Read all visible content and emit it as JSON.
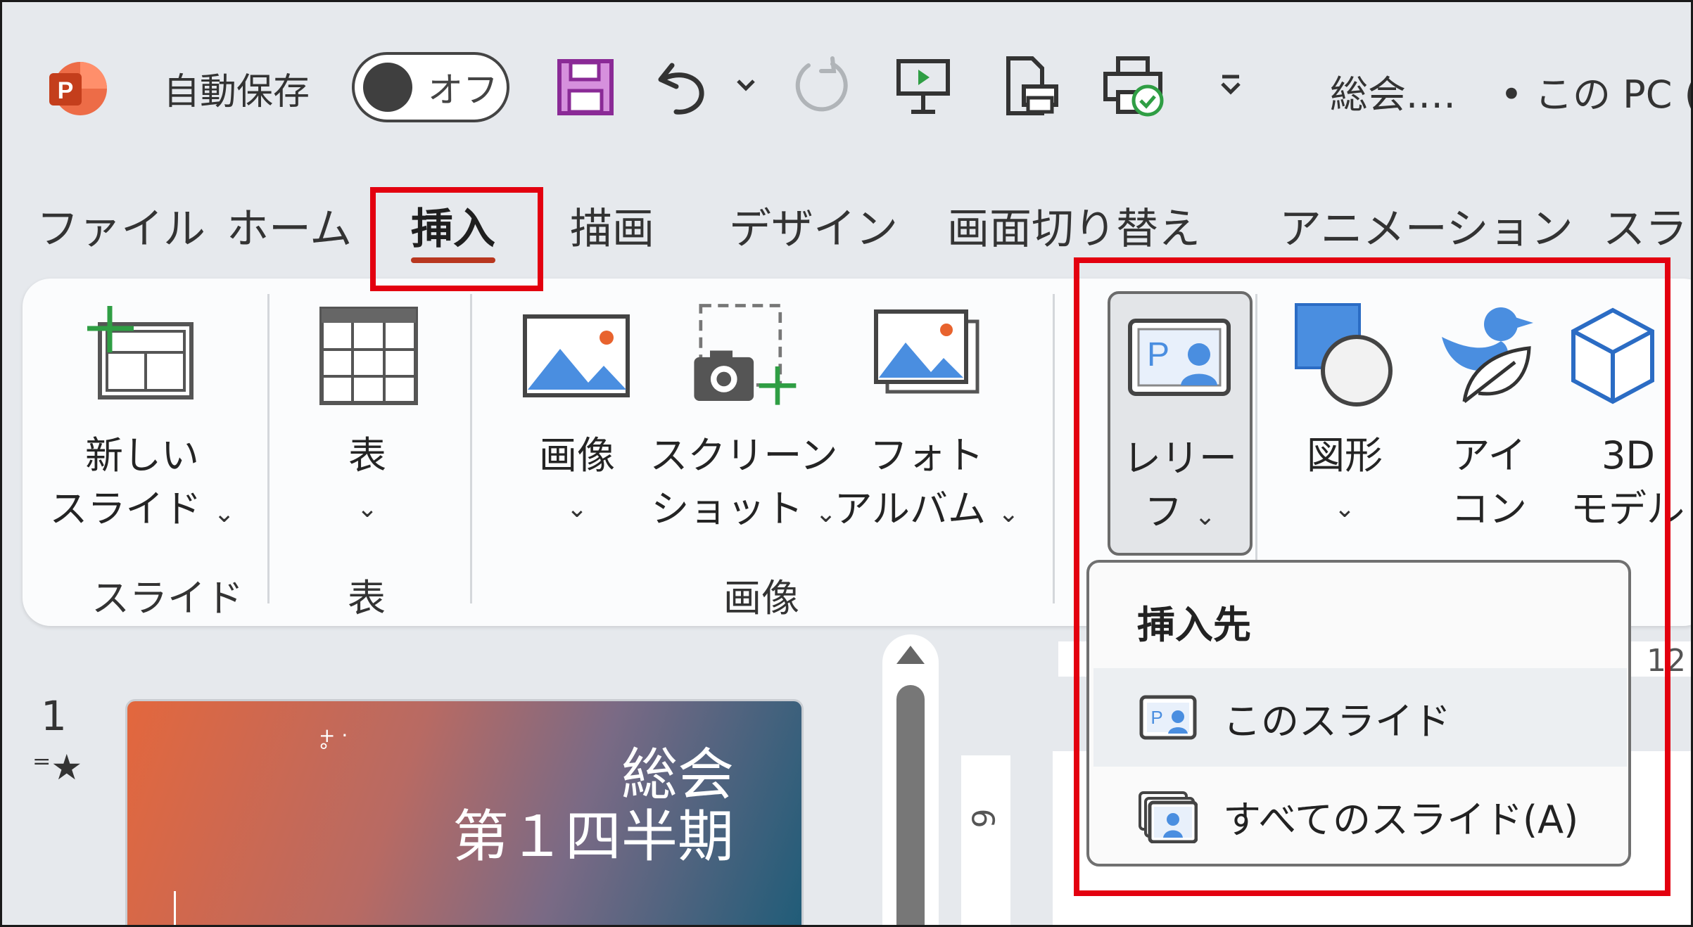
{
  "titlebar": {
    "autosave_label": "自動保存",
    "toggle_state": "オフ",
    "doc_title": "総会.…",
    "location": "• この PC (",
    "icons": [
      "powerpoint-logo-icon",
      "save-icon",
      "undo-icon",
      "chevron-down-icon",
      "redo-icon",
      "presentation-icon",
      "print-preview-icon",
      "printer-check-icon",
      "customize-quick-access-icon"
    ]
  },
  "tabs": [
    "ファイル",
    "ホーム",
    "挿入",
    "描画",
    "デザイン",
    "画面切り替え",
    "アニメーション",
    "スライ"
  ],
  "active_tab": "挿入",
  "ribbon": {
    "new_slide": {
      "line1": "新しい",
      "line2": "スライド"
    },
    "table": {
      "line1": "表"
    },
    "image": {
      "line1": "画像"
    },
    "screenshot": {
      "line1": "スクリーン",
      "line2": "ショット"
    },
    "photo_album": {
      "line1": "フォト",
      "line2": "アルバム"
    },
    "reef": {
      "line1": "レリー",
      "line2": "フ"
    },
    "shapes": {
      "line1": "図形"
    },
    "icons": {
      "line1": "アイ",
      "line2": "コン"
    },
    "model3d": {
      "line1": "3D",
      "line2": "モデル"
    },
    "groups": {
      "slides": "スライド",
      "table": "表",
      "images": "画像"
    }
  },
  "dropdown": {
    "header": "挿入先",
    "item1": "このスライド",
    "item2": "すべてのスライド(A)"
  },
  "slides_panel": {
    "slide_number": "1",
    "thumb_title1": "総会",
    "thumb_title2": "第１四半期"
  },
  "rulers": {
    "h_label": "12",
    "v_label": "6"
  },
  "colors": {
    "accent_red": "#e3000f",
    "tab_underline": "#b8371f",
    "icon_blue": "#4a8ee0"
  }
}
